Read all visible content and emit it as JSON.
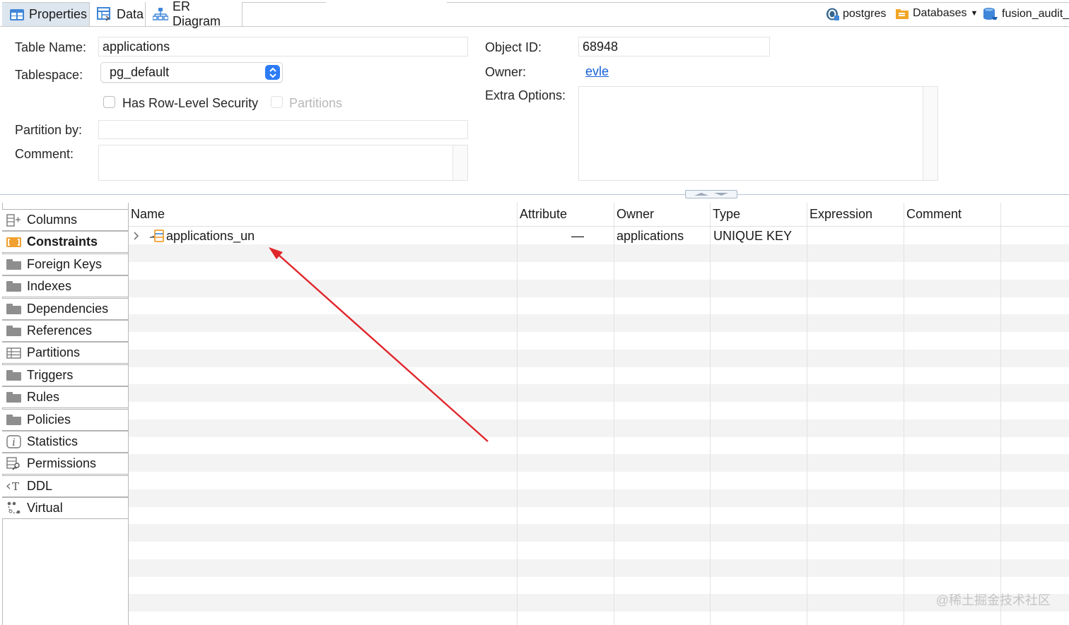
{
  "tabs": [
    {
      "label": "Properties",
      "icon": "properties-table-icon"
    },
    {
      "label": "Data",
      "icon": "data-grid-icon"
    },
    {
      "label": "ER Diagram",
      "icon": "er-diagram-icon"
    }
  ],
  "context": {
    "connection": "postgres",
    "databases": "Databases",
    "schema": "fusion_audit_"
  },
  "form": {
    "table_name_label": "Table Name:",
    "table_name": "applications",
    "tablespace_label": "Tablespace:",
    "tablespace": "pg_default",
    "row_security_label": "Has Row-Level Security",
    "partitions_label": "Partitions",
    "partition_by_label": "Partition by:",
    "partition_by": "",
    "comment_label": "Comment:",
    "comment": "",
    "object_id_label": "Object ID:",
    "object_id": "68948",
    "owner_label": "Owner:",
    "owner": "evle",
    "extra_options_label": "Extra Options:",
    "extra_options": ""
  },
  "nav": [
    {
      "label": "Columns",
      "icon": "columns-icon"
    },
    {
      "label": "Constraints",
      "icon": "constraints-icon",
      "active": true
    },
    {
      "label": "Foreign Keys",
      "icon": "folder-icon"
    },
    {
      "label": "Indexes",
      "icon": "folder-icon"
    },
    {
      "label": "Dependencies",
      "icon": "folder-icon"
    },
    {
      "label": "References",
      "icon": "folder-icon"
    },
    {
      "label": "Partitions",
      "icon": "partitions-icon"
    },
    {
      "label": "Triggers",
      "icon": "folder-icon"
    },
    {
      "label": "Rules",
      "icon": "folder-icon"
    },
    {
      "label": "Policies",
      "icon": "folder-icon"
    },
    {
      "label": "Statistics",
      "icon": "info-icon"
    },
    {
      "label": "Permissions",
      "icon": "permissions-icon"
    },
    {
      "label": "DDL",
      "icon": "ddl-icon"
    },
    {
      "label": "Virtual",
      "icon": "virtual-icon"
    }
  ],
  "grid": {
    "columns": [
      "Name",
      "Attribute",
      "Owner",
      "Type",
      "Expression",
      "Comment"
    ],
    "rows": [
      {
        "name": "applications_un",
        "attribute": "—",
        "owner": "applications",
        "type": "UNIQUE KEY",
        "expression": "",
        "comment": ""
      }
    ]
  },
  "annotation": {
    "color": "#e0262b"
  },
  "watermark": "@稀土掘金技术社区",
  "colors": {
    "accent": "#2d7cf6",
    "link": "#1560d6",
    "constraint_icon": "#f0a030"
  }
}
